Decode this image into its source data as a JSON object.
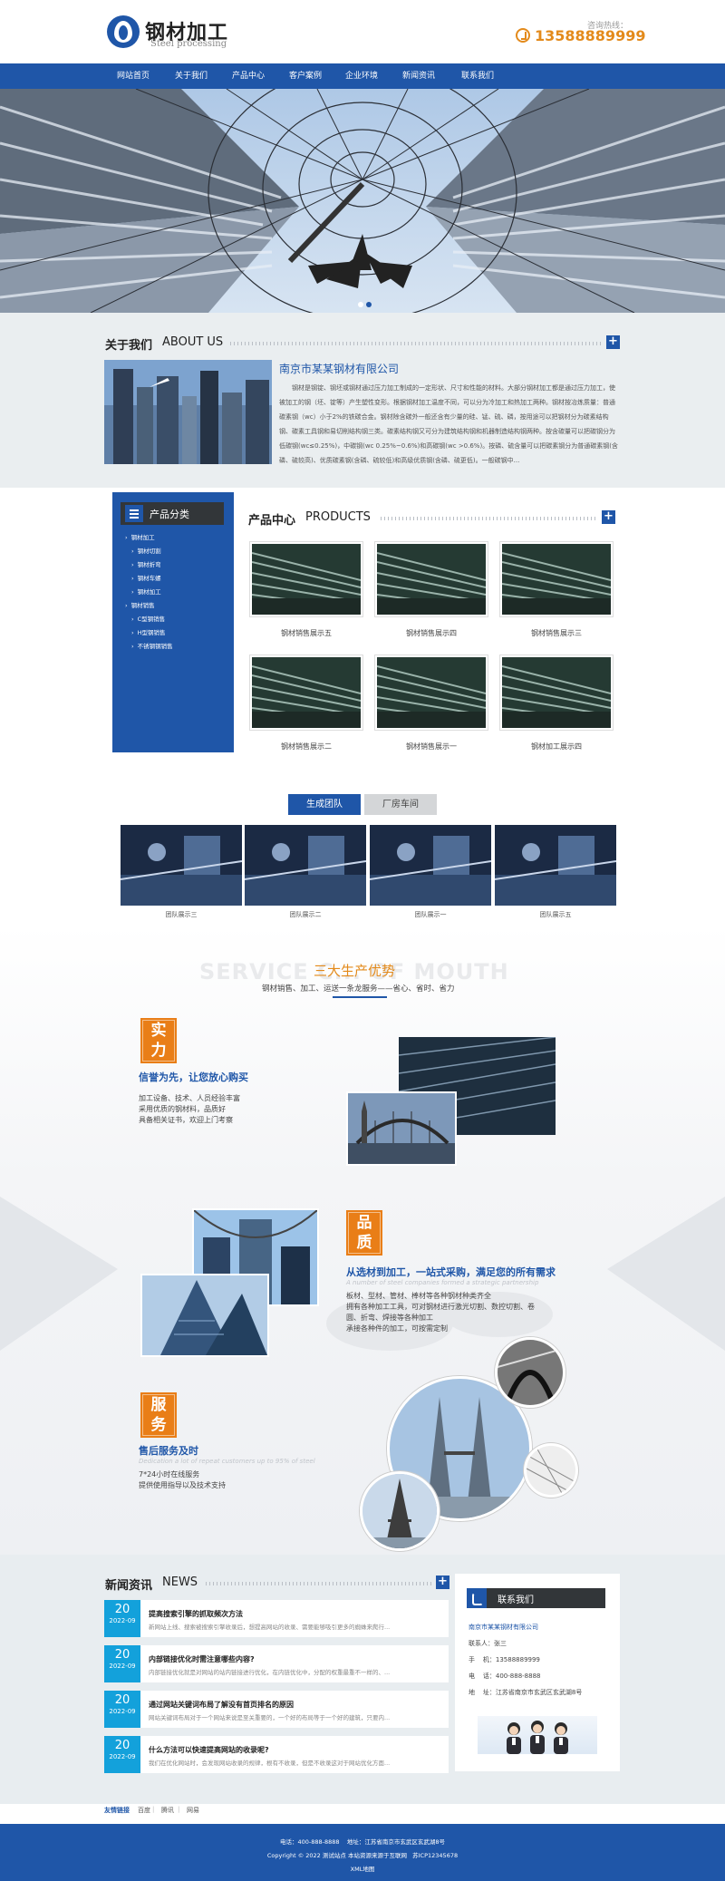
{
  "header": {
    "logo_title": "钢材加工",
    "logo_sub": "Steel processing",
    "hotline_label": "咨询热线：",
    "hotline_number": "13588889999"
  },
  "nav": {
    "items": [
      "网站首页",
      "关于我们",
      "产品中心",
      "客户案例",
      "企业环境",
      "新闻资讯",
      "联系我们"
    ]
  },
  "about": {
    "title_cn": "关于我们",
    "title_en": "ABOUT US",
    "company": "南京市某某钢材有限公司",
    "text": "钢材是钢锭、钢坯或钢材通过压力加工制成的一定形状、尺寸和性能的材料。大部分钢材加工都是通过压力加工，使被加工的钢（坯、锭等）产生塑性变形。根据钢材加工温度不同，可以分为冷加工和热加工两种。钢材按冶炼质量：普通碳素钢（wc）小于2%的铁碳合金。钢材除含碳外一般还含有少量的硅、锰、硫、磷，按用途可以把钢材分为碳素结构钢、碳素工具钢和易切削结构钢三类。碳素结构钢又可分为建筑结构钢和机器制造结构钢两种。按含碳量可以把碳钢分为低碳钢(wc≤0.25%)，中碳钢(wc 0.25%~0.6%)和高碳钢(wc >0.6%)。按磷、硫含量可以把碳素钢分为普通碳素钢(含磷、硫较高)、优质碳素钢(含磷、硫较低)和高级优质钢(含磷、硫更低)。一般碳钢中..."
  },
  "products": {
    "title_cn": "产品中心",
    "title_en": "PRODUCTS",
    "category_title": "产品分类",
    "categories": [
      {
        "label": "钢材加工",
        "level": 1
      },
      {
        "label": "钢材切割",
        "level": 2
      },
      {
        "label": "钢材折弯",
        "level": 2
      },
      {
        "label": "钢材车螺",
        "level": 2
      },
      {
        "label": "钢材加工",
        "level": 2
      },
      {
        "label": "钢材销售",
        "level": 1
      },
      {
        "label": "C型钢销售",
        "level": 2
      },
      {
        "label": "H型钢销售",
        "level": 2
      },
      {
        "label": "不锈钢钢销售",
        "level": 2
      }
    ],
    "items": [
      {
        "name": "钢材销售展示五"
      },
      {
        "name": "钢材销售展示四"
      },
      {
        "name": "钢材销售展示三"
      },
      {
        "name": "钢材销售展示二"
      },
      {
        "name": "钢材销售展示一"
      },
      {
        "name": "钢材加工展示四"
      }
    ]
  },
  "team": {
    "tabs": [
      "生成团队",
      "厂房车间"
    ],
    "active_tab": 0,
    "items": [
      {
        "name": "团队展示三"
      },
      {
        "name": "团队展示二"
      },
      {
        "name": "团队展示一"
      },
      {
        "name": "团队展示五"
      }
    ]
  },
  "advantages": {
    "bg_text": "SERVICE C... OF MOUTH",
    "title": "三大生产优势",
    "subtitle": "钢材销售、加工、运送一条龙服务——省心、省时、省力",
    "items": [
      {
        "badge": [
          "实",
          "力"
        ],
        "heading": "信誉为先，让您放心购买",
        "en": "",
        "lines": [
          "加工设备、技术、人员经验丰富",
          "采用优质的钢材料，品质好",
          "具备相关证书，欢迎上门考察"
        ]
      },
      {
        "badge": [
          "品",
          "质"
        ],
        "heading": "从选材到加工，一站式采购，满足您的所有需求",
        "en": "A number of steel companies formed a strategic partnership",
        "lines": [
          "板材、型材、管材、棒材等各种钢材种类齐全",
          "拥有各种加工工具，可对钢材进行激光切割、数控切割、卷",
          "圆、折弯、焊接等各种加工",
          "承接各种件的加工，可按需定制"
        ]
      },
      {
        "badge": [
          "服",
          "务"
        ],
        "heading": "售后服务及时",
        "en": "Dedication a lot of repeat customers up to 95% of steel",
        "lines": [
          "7*24小时在线服务",
          "提供使用指导以及技术支持"
        ]
      }
    ]
  },
  "news": {
    "title_cn": "新闻资讯",
    "title_en": "NEWS",
    "items": [
      {
        "day": "20",
        "ym": "2022-09",
        "title": "提高搜索引擎的抓取频次方法",
        "summary": "新网站上线、搜索被搜索引擎收录后，想提高网站的收录、需要能够吸引更多的蜘蛛来爬行..."
      },
      {
        "day": "20",
        "ym": "2022-09",
        "title": "内部链接优化时需注意哪些内容?",
        "summary": "内部链接优化就是对网站的站内链接进行优化，在内链优化中，分配的权重最重不一样的、..."
      },
      {
        "day": "20",
        "ym": "2022-09",
        "title": "通过网站关键词布局了解没有首页排名的原因",
        "summary": "网站关键词布局对于一个网站来说是至关重要的，一个好的布局等于一个好的建筑，只要内..."
      },
      {
        "day": "20",
        "ym": "2022-09",
        "title": "什么方法可以快速提高网站的收录呢?",
        "summary": "我们在优化网站时，会发现网站收录的规律，根有不收录，但是不收录这对于网站优化方面..."
      }
    ]
  },
  "contact": {
    "title": "联系我们",
    "company": "南京市某某钢材有限公司",
    "rows": [
      "联系人：张三",
      "手    机：13588889999",
      "电    话：400-888-8888",
      "地    址：江苏省南京市玄武区玄武湖8号"
    ]
  },
  "links": {
    "title": "友情链接",
    "items": [
      "百度",
      "腾讯",
      "网易"
    ]
  },
  "footer": {
    "line1": "电话：400-888-8888    地址：江苏省南京市玄武区玄武湖8号",
    "line2": "Copyright © 2022 测试站点 本站资源来源于互联网   苏ICP12345678",
    "line3": "XML地图"
  },
  "colors": {
    "primary": "#1f56a8",
    "accent": "#e38a1b",
    "dark": "#323639",
    "news_date": "#13a1db"
  }
}
